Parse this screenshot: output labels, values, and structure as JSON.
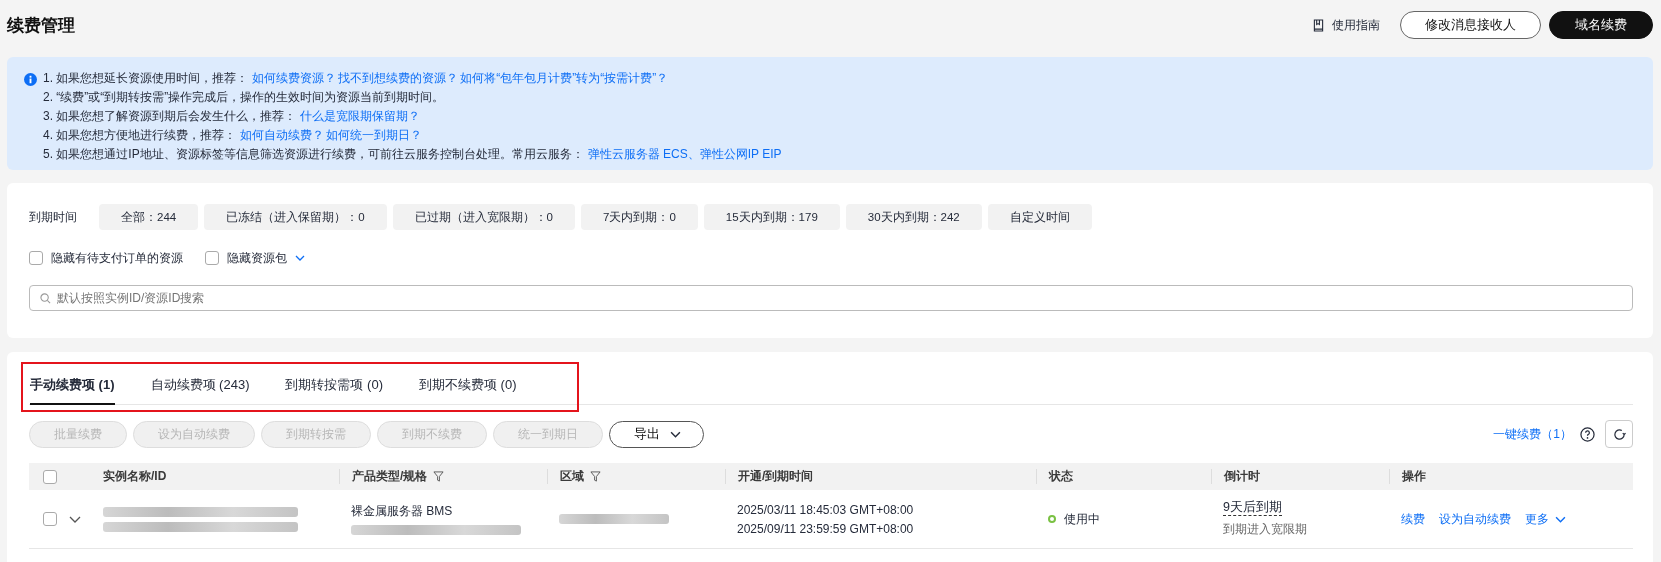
{
  "header": {
    "title": "续费管理",
    "guide_link": "使用指南",
    "buttons": [
      {
        "label": "修改消息接收人",
        "kind": "outline"
      },
      {
        "label": "域名续费",
        "kind": "primary"
      }
    ]
  },
  "notice": {
    "lines": [
      {
        "text": "1. 如果您想延长资源使用时间，推荐：",
        "links": [
          "如何续费资源？",
          "找不到想续费的资源？",
          "如何将“包年包月计费”转为“按需计费”？"
        ]
      },
      {
        "text": "2. “续费”或“到期转按需”操作完成后，操作的生效时间为资源当前到期时间。"
      },
      {
        "text": "3. 如果您想了解资源到期后会发生什么，推荐：",
        "links": [
          "什么是宽限期保留期？"
        ]
      },
      {
        "text": "4. 如果您想方便地进行续费，推荐：",
        "links": [
          "如何自动续费？",
          "如何统一到期日？"
        ]
      },
      {
        "text": "5. 如果您想通过IP地址、资源标签等信息筛选资源进行续费，可前往云服务控制台处理。常用云服务：",
        "links": [
          "弹性云服务器 ECS、弹性公网IP EIP"
        ]
      }
    ]
  },
  "filters": {
    "label": "到期时间",
    "chips": [
      {
        "label": "全部：244",
        "selected": false
      },
      {
        "label": "已冻结（进入保留期）：0",
        "selected": false
      },
      {
        "label": "已过期（进入宽限期）：0",
        "selected": false
      },
      {
        "label": "7天内到期：0",
        "selected": false
      },
      {
        "label": "15天内到期：179",
        "selected": false
      },
      {
        "label": "30天内到期：242",
        "selected": false
      },
      {
        "label": "自定义时间",
        "selected": false
      }
    ],
    "checkboxes": [
      {
        "label": "隐藏有待支付订单的资源",
        "checked": false,
        "dropdown": false
      },
      {
        "label": "隐藏资源包",
        "checked": false,
        "dropdown": true
      }
    ],
    "search": {
      "placeholder": "默认按照实例ID/资源ID搜索"
    }
  },
  "tabs": [
    {
      "label": "手动续费项 (1)",
      "selected": true
    },
    {
      "label": "自动续费项 (243)",
      "selected": false
    },
    {
      "label": "到期转按需项 (0)",
      "selected": false
    },
    {
      "label": "到期不续费项 (0)",
      "selected": false
    }
  ],
  "toolbar": {
    "buttons": [
      {
        "label": "批量续费",
        "disabled": true,
        "dropdown": false
      },
      {
        "label": "设为自动续费",
        "disabled": true,
        "dropdown": false
      },
      {
        "label": "到期转按需",
        "disabled": true,
        "dropdown": false
      },
      {
        "label": "到期不续费",
        "disabled": true,
        "dropdown": false
      },
      {
        "label": "统一到期日",
        "disabled": true,
        "dropdown": false
      },
      {
        "label": "导出",
        "disabled": false,
        "dropdown": true
      }
    ],
    "one_click_renew": "一键续费（1）"
  },
  "table": {
    "select_all_checked": false,
    "columns": [
      {
        "label": "实例名称/ID",
        "filterable": false
      },
      {
        "label": "产品类型/规格",
        "filterable": true
      },
      {
        "label": "区域",
        "filterable": true
      },
      {
        "label": "开通/到期时间",
        "filterable": false
      },
      {
        "label": "状态",
        "filterable": false
      },
      {
        "label": "倒计时",
        "filterable": false
      },
      {
        "label": "操作",
        "filterable": false
      }
    ],
    "rows": [
      {
        "checked": false,
        "product": "裸金属服务器 BMS",
        "start_time": "2025/03/11 18:45:03 GMT+08:00",
        "end_time": "2025/09/11 23:59:59 GMT+08:00",
        "status": {
          "label": "使用中",
          "color": "#7ac143"
        },
        "countdown": "9天后到期",
        "countdown_note": "到期进入宽限期",
        "actions": [
          "续费",
          "设为自动续费",
          "更多"
        ]
      }
    ]
  }
}
